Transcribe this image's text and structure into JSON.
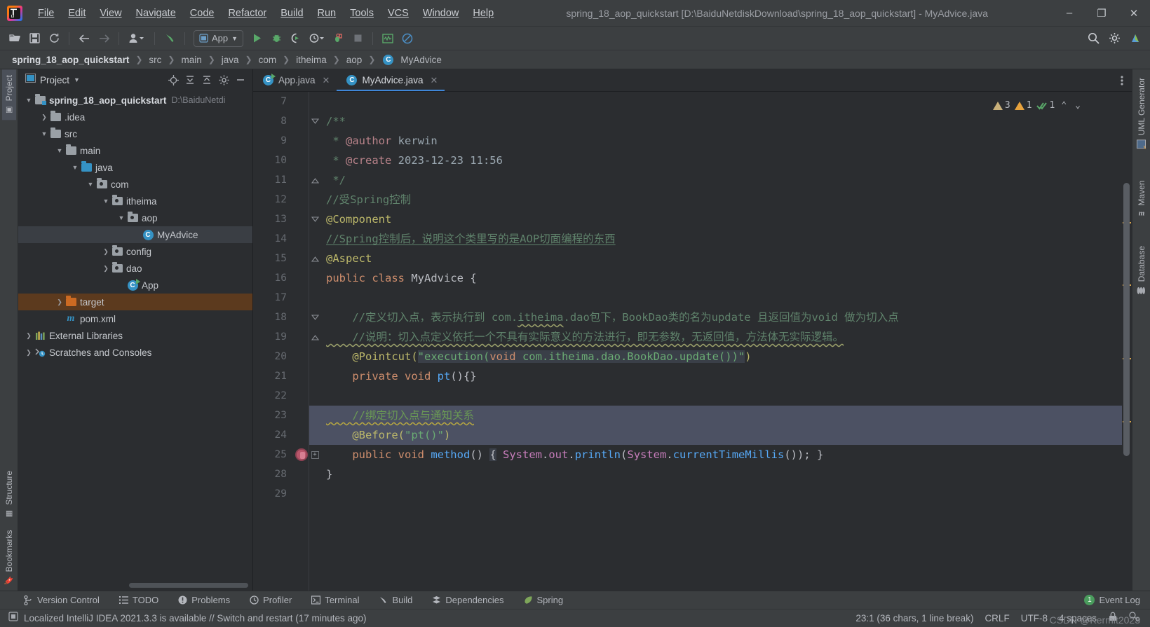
{
  "window": {
    "title": "spring_18_aop_quickstart [D:\\BaiduNetdiskDownload\\spring_18_aop_quickstart] - MyAdvice.java",
    "app_logo_text": "IJ",
    "minimize": "–",
    "maximize": "❐",
    "close": "✕"
  },
  "menu": [
    {
      "label": "File"
    },
    {
      "label": "Edit"
    },
    {
      "label": "View"
    },
    {
      "label": "Navigate"
    },
    {
      "label": "Code"
    },
    {
      "label": "Refactor"
    },
    {
      "label": "Build"
    },
    {
      "label": "Run"
    },
    {
      "label": "Tools"
    },
    {
      "label": "VCS"
    },
    {
      "label": "Window"
    },
    {
      "label": "Help"
    }
  ],
  "toolbar": {
    "open_icon": "open-folder-icon",
    "save_icon": "save-icon",
    "sync_icon": "refresh-icon",
    "back_icon": "arrow-left-icon",
    "forward_icon": "arrow-right-icon",
    "profile_icon": "user-dropdown-icon",
    "build_icon": "hammer-icon",
    "run_config_label": "App",
    "run_icon": "run-icon",
    "debug_icon": "debug-icon",
    "coverage_icon": "run-coverage-icon",
    "profiler_icon": "profile-run-icon",
    "build_project_icon": "build-project-icon",
    "stop_icon": "stop-icon",
    "monitor_icon": "monitor-icon",
    "block_icon": "no-entry-icon",
    "search_icon": "search-icon",
    "settings_icon": "gear-icon",
    "updates_icon": "updates-icon"
  },
  "breadcrumb": [
    {
      "label": "spring_18_aop_quickstart",
      "bold": true
    },
    {
      "label": "src"
    },
    {
      "label": "main"
    },
    {
      "label": "java"
    },
    {
      "label": "com"
    },
    {
      "label": "itheima"
    },
    {
      "label": "aop"
    },
    {
      "label": "MyAdvice",
      "icon": "class-icon"
    }
  ],
  "left_strip": {
    "top": [
      {
        "label": "Project",
        "icon": "project-folder-icon",
        "active": true
      }
    ],
    "bottom": [
      {
        "label": "Structure",
        "icon": "structure-icon"
      },
      {
        "label": "Bookmarks",
        "icon": "bookmark-icon"
      }
    ]
  },
  "right_strip": [
    {
      "label": "UML Generator",
      "icon": "uml-icon"
    },
    {
      "label": "Maven",
      "icon": "maven-icon"
    },
    {
      "label": "Database",
      "icon": "database-icon"
    }
  ],
  "project_panel": {
    "title": "Project",
    "dropdown_icon": "chevron-down-icon",
    "actions": [
      {
        "name": "locate-icon",
        "glyph": "⊕"
      },
      {
        "name": "expand-all-icon",
        "glyph": "↧"
      },
      {
        "name": "collapse-all-icon",
        "glyph": "↥"
      },
      {
        "name": "settings-gear-icon",
        "glyph": "⚙"
      },
      {
        "name": "hide-icon",
        "glyph": "—"
      }
    ],
    "tree": [
      {
        "depth": 0,
        "arrow": "down",
        "icon": "module-folder",
        "label": "spring_18_aop_quickstart",
        "bold": true,
        "path": "D:\\BaiduNetdi"
      },
      {
        "depth": 1,
        "arrow": "right",
        "icon": "folder-gray",
        "label": ".idea"
      },
      {
        "depth": 1,
        "arrow": "down",
        "icon": "folder-gray",
        "label": "src"
      },
      {
        "depth": 2,
        "arrow": "down",
        "icon": "folder-gray",
        "label": "main"
      },
      {
        "depth": 3,
        "arrow": "down",
        "icon": "folder-blue",
        "label": "java"
      },
      {
        "depth": 4,
        "arrow": "down",
        "icon": "package",
        "label": "com"
      },
      {
        "depth": 5,
        "arrow": "down",
        "icon": "package",
        "label": "itheima"
      },
      {
        "depth": 6,
        "arrow": "down",
        "icon": "package",
        "label": "aop"
      },
      {
        "depth": 7,
        "arrow": "none",
        "icon": "class",
        "label": "MyAdvice",
        "selected": true
      },
      {
        "depth": 6,
        "arrow": "right",
        "icon": "package",
        "label": "config"
      },
      {
        "depth": 6,
        "arrow": "right",
        "icon": "package",
        "label": "dao"
      },
      {
        "depth": 6,
        "arrow": "none",
        "icon": "class-run",
        "label": "App"
      },
      {
        "depth": 2,
        "arrow": "right",
        "icon": "folder-orange",
        "label": "target",
        "highlight": true
      },
      {
        "depth": 2,
        "arrow": "none",
        "icon": "maven",
        "label": "pom.xml"
      },
      {
        "depth": 0,
        "arrow": "right",
        "icon": "libraries",
        "label": "External Libraries"
      },
      {
        "depth": 0,
        "arrow": "right",
        "icon": "scratches",
        "label": "Scratches and Consoles"
      }
    ]
  },
  "editor": {
    "tabs": [
      {
        "label": "App.java",
        "icon": "class-run-icon",
        "active": false,
        "close": "✕"
      },
      {
        "label": "MyAdvice.java",
        "icon": "class-icon",
        "active": true,
        "close": "✕"
      }
    ],
    "tab_menu_icon": "more-vertical-icon",
    "inspection": {
      "weak_warning_count": "3",
      "warning_count": "1",
      "ok_count": "1",
      "up_icon": "⌃",
      "down_icon": "⌄"
    },
    "lines": [
      {
        "num": "7",
        "text": ""
      },
      {
        "num": "8",
        "fold": "open",
        "segs": [
          {
            "c": "doc",
            "t": "/**"
          }
        ]
      },
      {
        "num": "9",
        "segs": [
          {
            "c": "doc",
            "t": " * "
          },
          {
            "c": "doctag",
            "t": "@author"
          },
          {
            "c": "doctxt",
            "t": " kerwin"
          }
        ]
      },
      {
        "num": "10",
        "segs": [
          {
            "c": "doc",
            "t": " * "
          },
          {
            "c": "doctag",
            "t": "@create"
          },
          {
            "c": "doctxt",
            "t": " 2023-12-23 11:56"
          }
        ]
      },
      {
        "num": "11",
        "fold": "close",
        "segs": [
          {
            "c": "doc",
            "t": " */"
          }
        ]
      },
      {
        "num": "12",
        "segs": [
          {
            "c": "cmt",
            "t": "//受Spring控制"
          }
        ]
      },
      {
        "num": "13",
        "fold": "open",
        "segs": [
          {
            "c": "ann",
            "t": "@Component"
          }
        ]
      },
      {
        "num": "14",
        "segs": [
          {
            "c": "cmt u-line",
            "t": "//Spring控制后，说明这个类里写的是AOP切面编程的东西"
          }
        ]
      },
      {
        "num": "15",
        "fold": "close",
        "segs": [
          {
            "c": "ann",
            "t": "@Aspect"
          }
        ]
      },
      {
        "num": "16",
        "segs": [
          {
            "c": "kw",
            "t": "public class "
          },
          {
            "c": "cls",
            "t": "MyAdvice {"
          }
        ]
      },
      {
        "num": "17",
        "text": ""
      },
      {
        "num": "18",
        "fold": "open",
        "segs": [
          {
            "c": "cmt",
            "t": "    //定义切入点，表示执行到 com."
          },
          {
            "c": "cmt wavy-g",
            "t": "itheima"
          },
          {
            "c": "cmt",
            "t": ".dao包下，BookDao类的名为update 且返回值为void 做为切入点"
          }
        ]
      },
      {
        "num": "19",
        "fold": "close",
        "segs": [
          {
            "c": "cmt wavy-g",
            "t": "    //说明：切入点定义依托一个不具有实际意义的方法进行，即无参数，无返回值，方法体无实际逻辑。"
          }
        ]
      },
      {
        "num": "20",
        "segs": [
          {
            "c": "ann",
            "t": "    @Pointcut("
          },
          {
            "c": "str pc-hl",
            "t": "\"execution("
          },
          {
            "c": "kw pc-hl",
            "t": "void"
          },
          {
            "c": "str pc-hl",
            "t": " com.itheima.dao.BookDao.update())\""
          },
          {
            "c": "ann",
            "t": ")"
          }
        ]
      },
      {
        "num": "21",
        "segs": [
          {
            "c": "kw",
            "t": "    private void "
          },
          {
            "c": "mth",
            "t": "pt"
          },
          {
            "c": "cls",
            "t": "(){}"
          }
        ]
      },
      {
        "num": "22",
        "text": ""
      },
      {
        "num": "23",
        "highlight": true,
        "segs": [
          {
            "c": "cmt-hl wavy",
            "t": "    //绑定切入点与通知关系"
          }
        ]
      },
      {
        "num": "24",
        "highlight": true,
        "segs": [
          {
            "c": "ann",
            "t": "    @Before("
          },
          {
            "c": "str",
            "t": "\"pt()\""
          },
          {
            "c": "ann",
            "t": ")"
          }
        ]
      },
      {
        "num": "25",
        "bean": true,
        "fold": "box",
        "segs": [
          {
            "c": "kw",
            "t": "    public void "
          },
          {
            "c": "mth",
            "t": "method"
          },
          {
            "c": "cls",
            "t": "() "
          },
          {
            "c": "cls pc-hl",
            "t": "{"
          },
          {
            "c": "cls",
            "t": " "
          },
          {
            "c": "fld",
            "t": "System"
          },
          {
            "c": "cls",
            "t": "."
          },
          {
            "c": "fld",
            "t": "out"
          },
          {
            "c": "cls",
            "t": "."
          },
          {
            "c": "mth",
            "t": "println"
          },
          {
            "c": "cls",
            "t": "("
          },
          {
            "c": "fld",
            "t": "System"
          },
          {
            "c": "cls",
            "t": "."
          },
          {
            "c": "mth",
            "t": "currentTimeMillis"
          },
          {
            "c": "cls",
            "t": "()); }"
          }
        ]
      },
      {
        "num": "28",
        "segs": [
          {
            "c": "cls",
            "t": "}"
          }
        ]
      },
      {
        "num": "29",
        "text": ""
      }
    ]
  },
  "bottom_tools": [
    {
      "label": "Version Control",
      "icon": "branch-icon"
    },
    {
      "label": "TODO",
      "icon": "todo-list-icon"
    },
    {
      "label": "Problems",
      "icon": "problems-icon"
    },
    {
      "label": "Profiler",
      "icon": "profiler-icon"
    },
    {
      "label": "Terminal",
      "icon": "terminal-icon"
    },
    {
      "label": "Build",
      "icon": "hammer-icon"
    },
    {
      "label": "Dependencies",
      "icon": "dependencies-icon"
    },
    {
      "label": "Spring",
      "icon": "spring-leaf-icon"
    }
  ],
  "event_log": {
    "count": "1",
    "label": "Event Log"
  },
  "statusbar": {
    "message_icon": "notification-icon",
    "message": "Localized IntelliJ IDEA 2021.3.3 is available // Switch and restart (17 minutes ago)",
    "caret": "23:1 (36 chars, 1 line break)",
    "line_sep": "CRLF",
    "encoding": "UTF-8",
    "indent": "4 spaces",
    "lock_icon": "lock-icon",
    "inspect_icon": "inspection-icon",
    "watermark": "CSDN @Kermit2023"
  },
  "colors": {
    "accent_blue": "#3f87d9",
    "selection": "#4c5163",
    "target_folder": "#5c3a1e",
    "warning": "#e8a33d",
    "weak_warning": "#c9b07a",
    "ok_green": "#4a9c5d"
  }
}
